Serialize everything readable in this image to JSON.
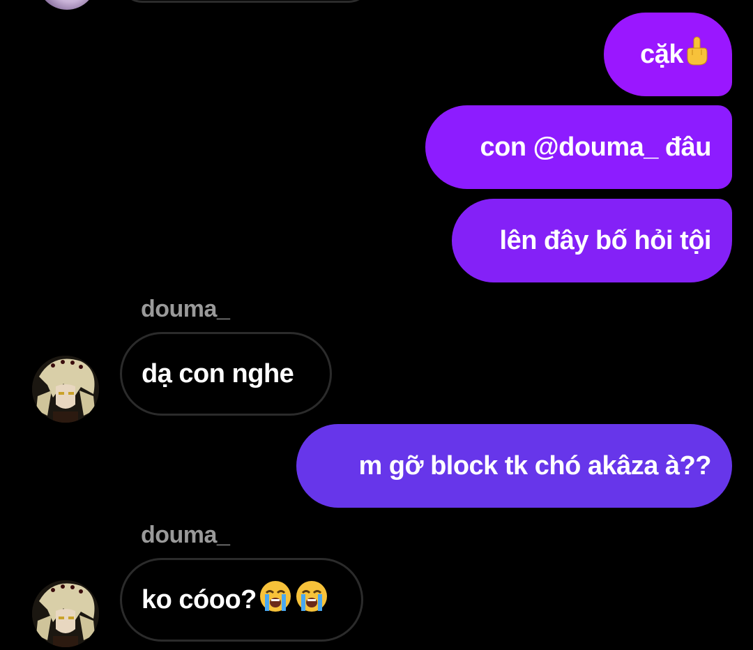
{
  "messages": [
    {
      "direction": "outgoing",
      "text": "cặk",
      "emoji": "middle-finger-emoji"
    },
    {
      "direction": "outgoing",
      "text": "con @douma_ đâu"
    },
    {
      "direction": "outgoing",
      "text": "lên đây bố hỏi tội"
    },
    {
      "direction": "incoming",
      "sender": "douma_",
      "text": "dạ con nghe"
    },
    {
      "direction": "outgoing",
      "text": "m gỡ block tk chó akâza à??"
    },
    {
      "direction": "incoming",
      "sender": "douma_",
      "text": "ko cóoo?",
      "emoji": "loudly-crying-face-emoji x2"
    }
  ],
  "colors": {
    "background": "#000000",
    "outgoing_bubble_top": "#9a17ff",
    "outgoing_bubble_bottom": "#6736ea",
    "incoming_bubble_border": "#2b2b2b",
    "sender_name": "#9a9a9a",
    "text": "#ffffff"
  }
}
